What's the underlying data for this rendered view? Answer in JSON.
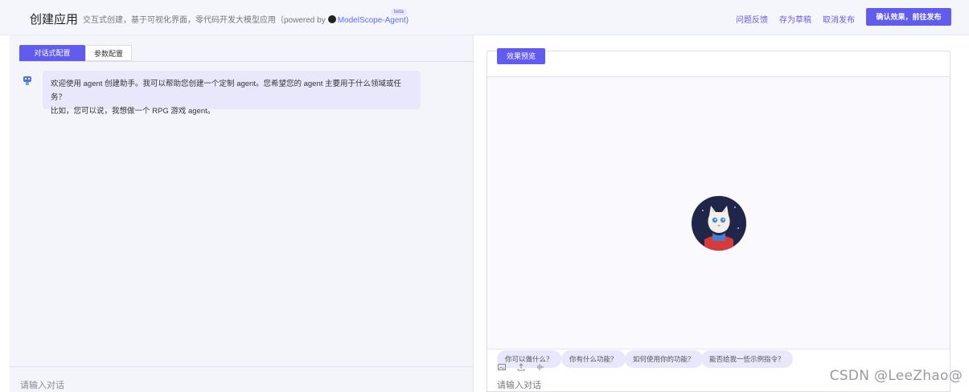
{
  "header": {
    "title": "创建应用",
    "subtitle": "交互式创建，基于可视化界面，零代码开发大模型应用（powered by",
    "repo_link": "ModelScope-Agent)",
    "beta": "beta",
    "feedback": "问题反馈",
    "save_draft": "存为草稿",
    "cancel_publish": "取消发布",
    "publish_button": "确认效果，前往发布"
  },
  "left": {
    "tabs": [
      {
        "label": "对话式配置",
        "active": true
      },
      {
        "label": "参数配置",
        "active": false
      }
    ],
    "message": {
      "line1": "欢迎使用 agent 创建助手。我可以帮助您创建一个定制 agent。您希望您的 agent 主要用于什么领域或任务？",
      "line2": "比如，您可以说，我想做一个 RPG 游戏 agent。"
    },
    "input_placeholder": "请输入对话"
  },
  "right": {
    "tab_label": "效果预览",
    "suggestions": [
      "你可以做什么？",
      "你有什么功能？",
      "如何使用你的功能？",
      "能否给我一些示例指令？"
    ],
    "tools": [
      "image-upload-icon",
      "file-upload-icon",
      "audio-icon"
    ],
    "input_placeholder": "请输入对话"
  },
  "watermark": "CSDN @LeeZhao@",
  "colors": {
    "accent": "#615ced",
    "bubble": "#e9e7fb",
    "panel_bg": "#f4f4fb"
  }
}
